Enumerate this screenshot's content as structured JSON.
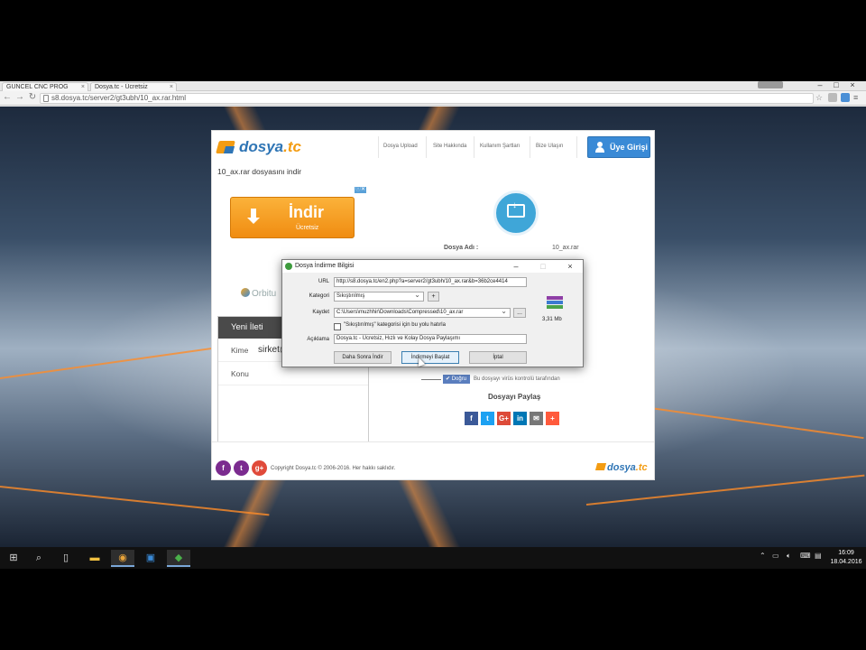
{
  "browser": {
    "tabs": [
      {
        "label": "GUNCEL CNC PROG"
      },
      {
        "label": "Dosya.tc - Ücretsiz"
      }
    ],
    "address": "s8.dosya.tc/server2/gt3ubh/10_ax.rar.html"
  },
  "site": {
    "logo_text": "dosya",
    "logo_tld": ".tc",
    "nav": [
      "Dosya Upload",
      "Site Hakkında",
      "Kullanım Şartları",
      "Bize Ulaşın"
    ],
    "login_label": "Üye Girişi",
    "file_title": "10_ax.rar dosyasını indir",
    "download_button": {
      "label": "İndir",
      "sub": "Ücretsiz"
    },
    "file_name_label": "Dosya Adı :",
    "file_name_value": "10_ax.rar",
    "orbitum": "Orbitu",
    "message_box": {
      "header": "Yeni İleti",
      "to_label": "Kime",
      "to_value": "sirket@",
      "subject_label": "Konu"
    },
    "check_tag": "✔ Doğru",
    "check_text": "Bu dosyayı virüs kontrolü tarafından",
    "share_title": "Dosyayı Paylaş",
    "share_icons": [
      "f",
      "t",
      "G+",
      "in",
      "✉",
      "+"
    ],
    "copyright": "Copyright Dosya.tc © 2006-2016. Her hakkı saklıdır.",
    "footer_logo": "dosya",
    "footer_tld": ".tc"
  },
  "dialog": {
    "title": "Dosya İndirme Bilgisi",
    "url_label": "URL",
    "url_value": "http://s8.dosya.tc/en2.php?a=server2/gt3ubh/10_ax.rar&b=36b2ce4414",
    "category_label": "Kategori",
    "category_value": "Sıkıştırılmış",
    "save_label": "Kaydet",
    "save_value": "C:\\Users\\muzhhir\\Downloads\\Compressed\\10_ax.rar",
    "remember_label": "\"Sıkıştırılmış\" kategorisi için bu yolu hatırla",
    "desc_label": "Açıklama",
    "desc_value": "Dosya.tc - Ücretsiz, Hızlı ve Kolay Dosya Paylaşımı",
    "size_value": "3,31  Mb",
    "buttons": {
      "later": "Daha Sonra İndir",
      "start": "İndirmeyi Başlat",
      "cancel": "İptal"
    },
    "plus_label": "+",
    "browse_label": "..."
  },
  "taskbar": {
    "time": "16:09",
    "date": "18.04.2016"
  },
  "colors": {
    "brand_blue": "#2f75b5",
    "brand_orange": "#f39c12",
    "download_orange": "#f08c11"
  }
}
